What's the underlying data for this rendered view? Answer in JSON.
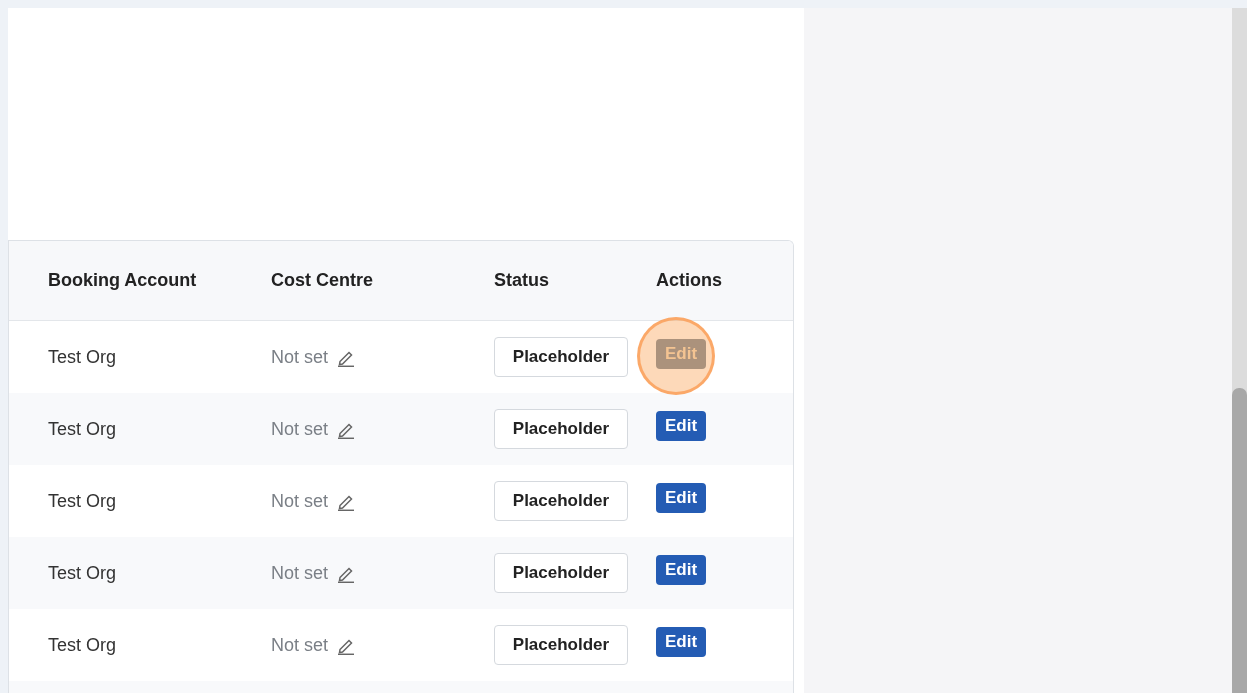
{
  "table": {
    "columns": [
      "Booking Account",
      "Cost Centre",
      "Status",
      "Actions"
    ],
    "rows": [
      {
        "booking_account": "Test Org",
        "cost_centre": "Not set",
        "status": "Placeholder",
        "action": "Edit",
        "highlighted": true
      },
      {
        "booking_account": "Test Org",
        "cost_centre": "Not set",
        "status": "Placeholder",
        "action": "Edit",
        "highlighted": false
      },
      {
        "booking_account": "Test Org",
        "cost_centre": "Not set",
        "status": "Placeholder",
        "action": "Edit",
        "highlighted": false
      },
      {
        "booking_account": "Test Org",
        "cost_centre": "Not set",
        "status": "Placeholder",
        "action": "Edit",
        "highlighted": false
      },
      {
        "booking_account": "Test Org",
        "cost_centre": "Not set",
        "status": "Placeholder",
        "action": "Edit",
        "highlighted": false
      }
    ]
  }
}
